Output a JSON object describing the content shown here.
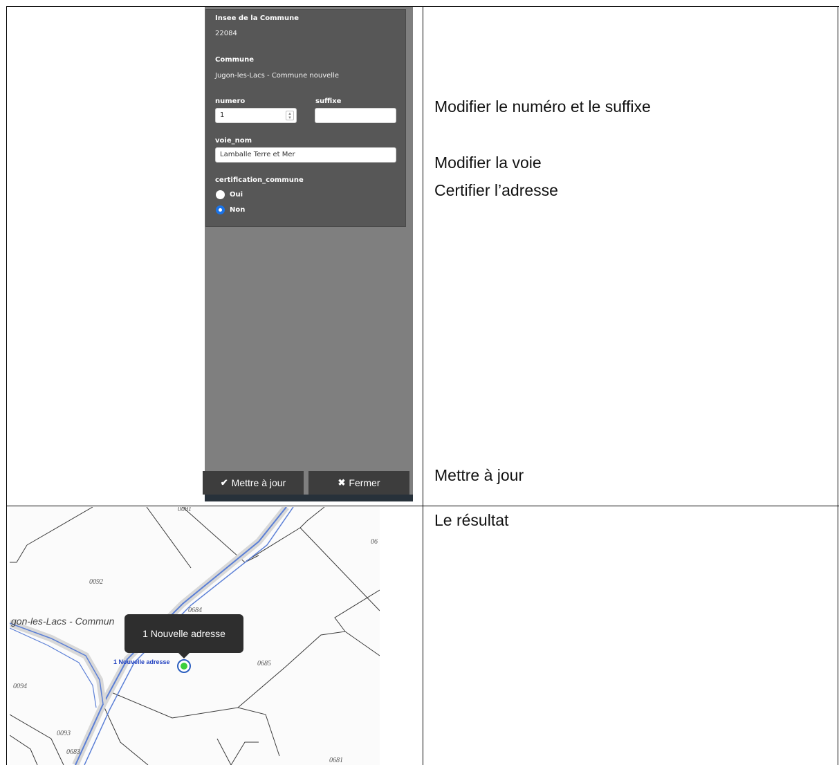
{
  "form": {
    "insee_label": "Insee de la Commune",
    "insee_value": "22084",
    "commune_label": "Commune",
    "commune_value": "Jugon-les-Lacs - Commune nouvelle",
    "numero_label": "numero",
    "numero_value": "1",
    "suffixe_label": "suffixe",
    "suffixe_value": "",
    "voie_label": "voie_nom",
    "voie_value": "Lamballe Terre et Mer",
    "certification_label": "certification_commune",
    "option_oui": "Oui",
    "option_non": "Non",
    "selected_option": "Non"
  },
  "buttons": {
    "update_label": "Mettre à jour",
    "close_label": "Fermer",
    "update_icon": "check-icon",
    "close_icon": "close-icon"
  },
  "notes": {
    "edit_number": "Modifier le numéro et le suffixe",
    "edit_road": "Modifier la voie",
    "certify": "Certifier l’adresse",
    "update": "Mettre à jour",
    "result": "Le résultat"
  },
  "map": {
    "commune_label": "gon-les-Lacs - Commun",
    "point_label": "1  Nouvelle adresse",
    "tooltip": "1 Nouvelle adresse",
    "parcels": [
      "0091",
      "0092",
      "0684",
      "0685",
      "0094",
      "0093",
      "0683",
      "0681",
      "06"
    ],
    "colors": {
      "road": "#5b7fd6",
      "point": "#3ccf3c",
      "point_ring": "#2c5fbf"
    }
  }
}
